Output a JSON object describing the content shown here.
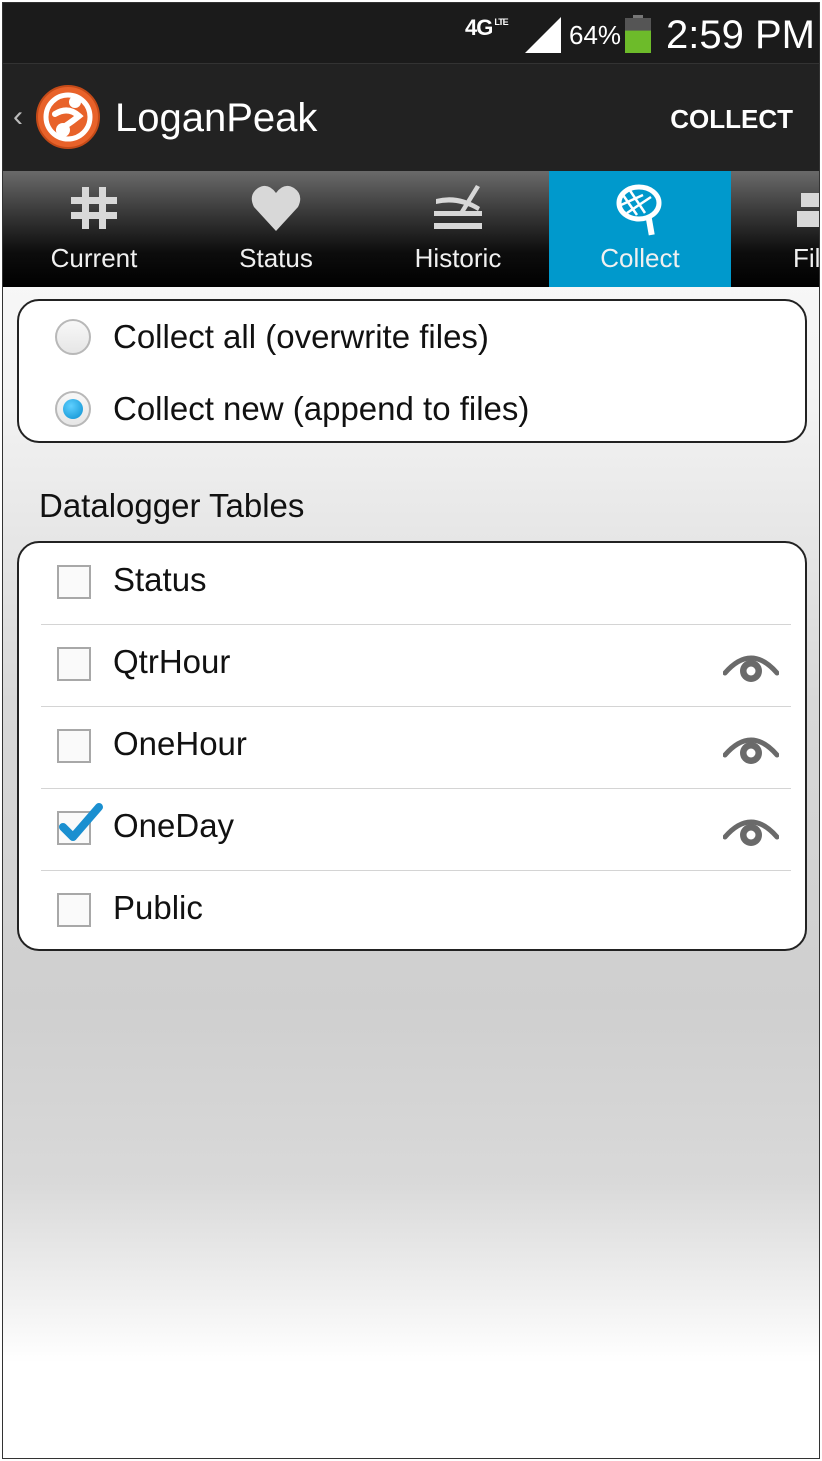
{
  "status_bar": {
    "network": "4G",
    "network_sub": "LTE",
    "battery_percent": "64%",
    "battery_level": 0.64,
    "time": "2:59 PM"
  },
  "action_bar": {
    "title": "LoganPeak",
    "action_label": "COLLECT"
  },
  "tabs": [
    {
      "label": "Current",
      "icon": "grid-hash-icon",
      "active": false
    },
    {
      "label": "Status",
      "icon": "heart-icon",
      "active": false
    },
    {
      "label": "Historic",
      "icon": "historic-graph-icon",
      "active": false
    },
    {
      "label": "Collect",
      "icon": "net-icon",
      "active": true
    },
    {
      "label": "Fil",
      "icon": "files-icon",
      "active": false
    }
  ],
  "collect_mode": {
    "options": [
      {
        "label": "Collect all (overwrite files)",
        "selected": false
      },
      {
        "label": "Collect new (append to files)",
        "selected": true
      }
    ]
  },
  "tables_section": {
    "title": "Datalogger Tables",
    "rows": [
      {
        "label": "Status",
        "checked": false,
        "has_view": false
      },
      {
        "label": "QtrHour",
        "checked": false,
        "has_view": true
      },
      {
        "label": "OneHour",
        "checked": false,
        "has_view": true
      },
      {
        "label": "OneDay",
        "checked": true,
        "has_view": true
      },
      {
        "label": "Public",
        "checked": false,
        "has_view": false
      }
    ]
  },
  "colors": {
    "accent": "#0099cc",
    "action_bar": "#222222",
    "battery_green": "#6dbb2a",
    "logo_orange": "#e8622a"
  }
}
